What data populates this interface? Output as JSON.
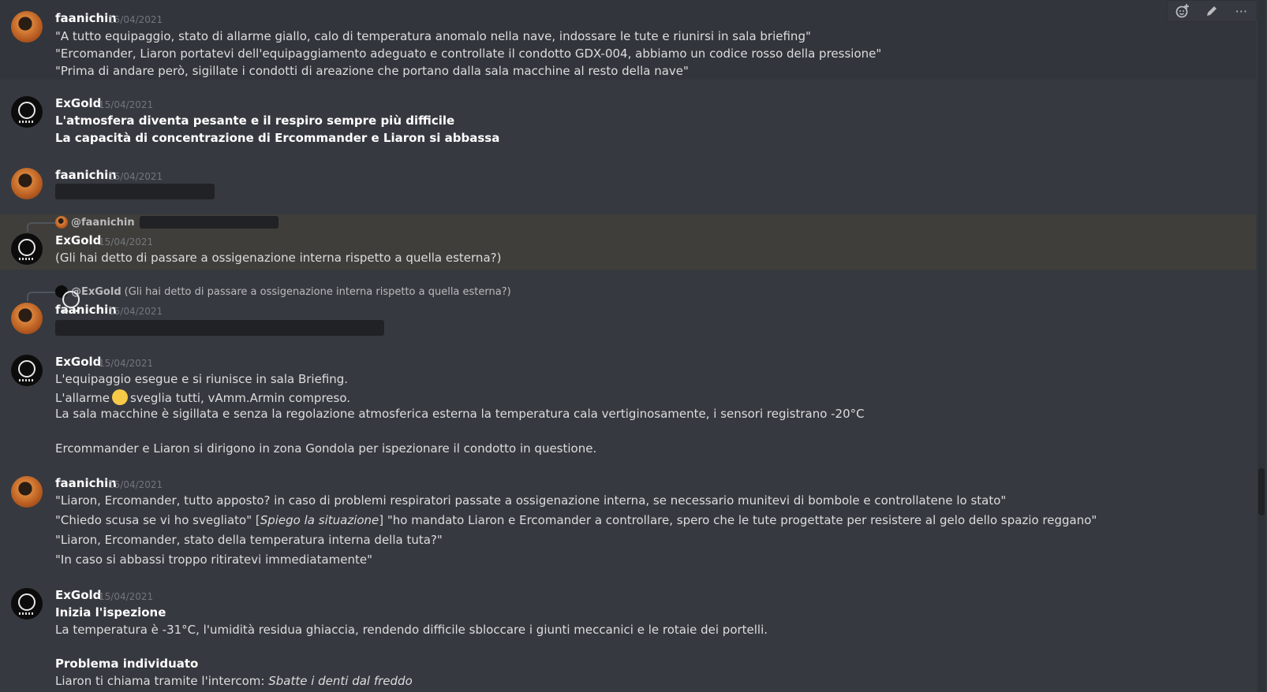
{
  "toolbar": {
    "icons": [
      "add-reaction-icon",
      "edit-icon",
      "more-options-icon"
    ],
    "more_label": "···"
  },
  "messages": [
    {
      "author": "faanichin",
      "timestamp": "15/04/2021",
      "lines": [
        "\"A tutto equipaggio, stato di allarme giallo, calo di temperatura anomalo nella nave, indossare le tute e riunirsi in sala briefing\"",
        "\"Ercomander, Liaron portatevi dell'equipaggiamento adeguato e controllate il condotto GDX-004, abbiamo un codice rosso della pressione\"",
        "\"Prima di andare però, sigillate i condotti di areazione che portano dalla sala macchine al resto della nave\""
      ]
    },
    {
      "author": "ExGold",
      "timestamp": "15/04/2021",
      "lines": [
        "L'atmosfera diventa pesante e il respiro sempre più difficile",
        "La capacità di concentrazione di Ercommander e Liaron si abbassa"
      ]
    },
    {
      "author": "faanichin",
      "timestamp": "15/04/2021",
      "spoiler": true
    },
    {
      "reply_to": "@faanichin",
      "author": "ExGold",
      "timestamp": "15/04/2021",
      "lines": [
        "(Gli hai detto di passare a ossigenazione interna rispetto a quella esterna?)"
      ]
    },
    {
      "reply_to": "@ExGold",
      "reply_text": "(Gli hai detto di passare a ossigenazione interna rispetto a quella esterna?)",
      "author": "faanichin",
      "timestamp": "15/04/2021",
      "spoiler": true
    },
    {
      "author": "ExGold",
      "timestamp": "15/04/2021",
      "lines": [
        "L'equipaggio esegue e si riunisce in sala Briefing.",
        "L'allarme",
        "sveglia tutti, vAmm.Armin compreso.",
        "La sala macchine è sigillata e senza la regolazione atmosferica esterna la temperatura cala vertiginosamente, i sensori registrano -20°C",
        "Ercommander e Liaron si dirigono in zona Gondola per ispezionare il condotto in questione."
      ]
    },
    {
      "author": "faanichin",
      "timestamp": "15/04/2021",
      "lines": [
        "\"Liaron, Ercomander, tutto apposto? in caso di problemi respiratori passate a ossigenazione interna, se necessario munitevi di bombole e controllatene lo stato\"",
        "\"Chiedo scusa se vi ho svegliato\" [",
        "Spiego la situazione",
        "] \"ho mandato Liaron e Ercomander a controllare, spero che le tute progettate per resistere al gelo dello spazio reggano\"",
        "\"Liaron, Ercomander, stato della temperatura interna della tuta?\"",
        "\"In caso si abbassi troppo ritiratevi immediatamente\""
      ]
    },
    {
      "author": "ExGold",
      "timestamp": "15/04/2021",
      "lines": [
        "Inizia l'ispezione",
        "La temperatura è -31°C, l'umidità residua ghiaccia, rendendo difficile sbloccare i giunti meccanici e le rotaie dei portelli.",
        "Problema individuato",
        "Liaron ti chiama tramite l'intercom:",
        "Sbatte i denti dal freddo"
      ]
    }
  ]
}
